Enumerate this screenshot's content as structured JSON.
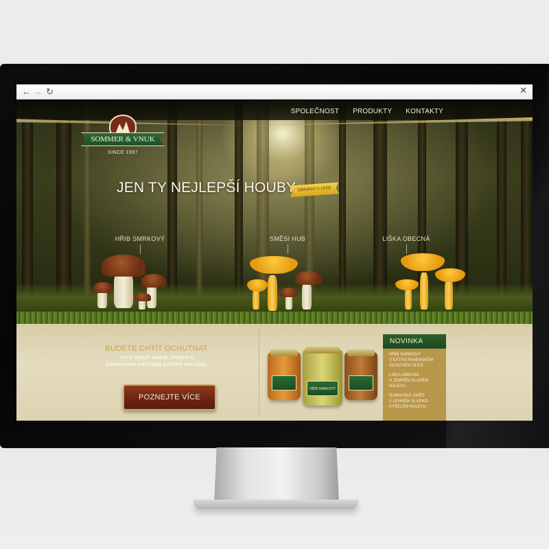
{
  "browser": {
    "back_icon": "←",
    "forward_icon": "→",
    "reload_icon": "↻",
    "close_icon": "✕"
  },
  "nav": {
    "items": [
      "SPOLEČNOST",
      "PRODUKTY",
      "KONTAKTY"
    ]
  },
  "logo": {
    "name": "SOMMER & VNUK",
    "since": "SINCE 1997"
  },
  "hero": {
    "headline": "JEN TY NEJLEPŠÍ HOUBY",
    "badge": "SBÍRÁNO V LESE",
    "products": [
      "HŘIB SMRKOVÝ",
      "SMĚSI HUB",
      "LIŠKA OBECNÁ"
    ]
  },
  "promo": {
    "title": "BUDETE CHTÍT OCHUTNAT",
    "description": "Jen ty nejlepší sušené, mražené a konzervované lesní houby a čerstvé lesní plody",
    "cta": "POZNEJTE VÍCE"
  },
  "jars": {
    "labels": [
      "",
      "HŘIB SMRKOVÝ",
      ""
    ]
  },
  "novinka": {
    "title": "NOVINKA",
    "items": [
      "HŘIB SMRKOVÝ\nV EXTRA PANENSKÉM\nOLIVOVÉM OLEJI",
      "LIŠKA OBECNÁ\nV JEMNĚM SLANÉM\nNÁLEVU",
      "ŠUMAVSKÁ SMĚS\nV LEHKÉM SLADKO-\nKYSELÉM NÁLEVU"
    ]
  },
  "colors": {
    "accent_gold": "#c9a24a",
    "brand_green": "#1d5127",
    "cta_brown": "#6a2310",
    "panel_beige": "#e4dcbf"
  }
}
